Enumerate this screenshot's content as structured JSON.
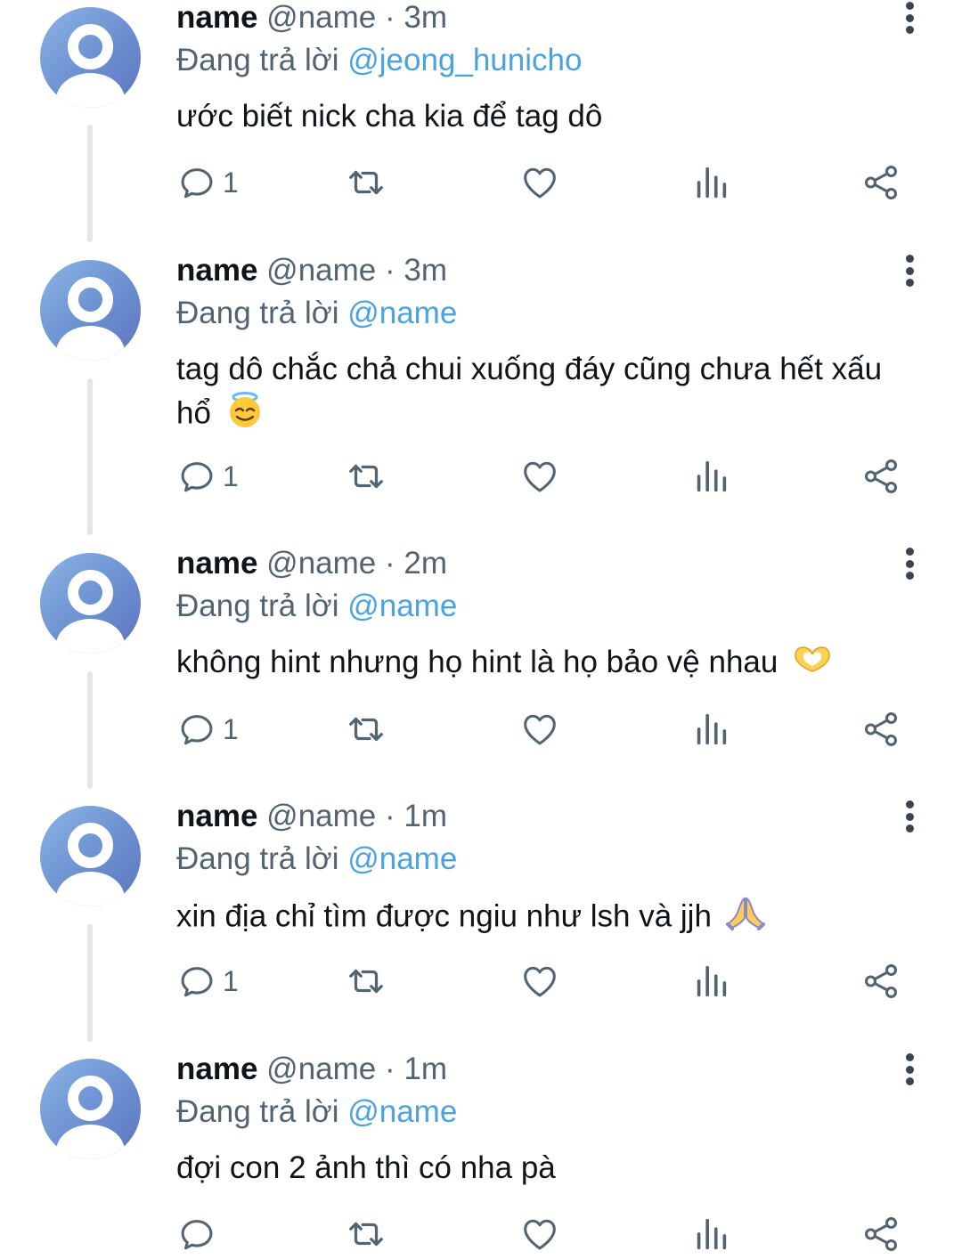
{
  "colors": {
    "mention": "#4aa3df",
    "muted": "#536471",
    "text": "#0f1419",
    "thread_line": "#e3e6e9"
  },
  "tweets": [
    {
      "name": "name",
      "handle": "@name",
      "sep": "·",
      "time": "3m",
      "reply_prefix": "Đang trả lời",
      "reply_to": "@jeong_hunicho",
      "text": "ước biết nick cha kia để tag dô",
      "emoji": "",
      "reply_count": "1"
    },
    {
      "name": "name",
      "handle": "@name",
      "sep": "·",
      "time": "3m",
      "reply_prefix": "Đang trả lời",
      "reply_to": "@name",
      "text": "tag dô chắc chả chui xuống đáy cũng chưa hết xấu hổ",
      "emoji": "smiling-face-with-halo-emoji",
      "reply_count": "1"
    },
    {
      "name": "name",
      "handle": "@name",
      "sep": "·",
      "time": "2m",
      "reply_prefix": "Đang trả lời",
      "reply_to": "@name",
      "text": "không hint nhưng họ hint là họ bảo vệ nhau",
      "emoji": "heart-hands-emoji",
      "reply_count": "1"
    },
    {
      "name": "name",
      "handle": "@name",
      "sep": "·",
      "time": "1m",
      "reply_prefix": "Đang trả lời",
      "reply_to": "@name",
      "text": "xin địa chỉ tìm được ngiu như lsh và jjh",
      "emoji": "folded-hands-emoji",
      "reply_count": "1"
    },
    {
      "name": "name",
      "handle": "@name",
      "sep": "·",
      "time": "1m",
      "reply_prefix": "Đang trả lời",
      "reply_to": "@name",
      "text": "đợi con 2 ảnh thì có nha pà",
      "emoji": "",
      "reply_count": ""
    }
  ]
}
